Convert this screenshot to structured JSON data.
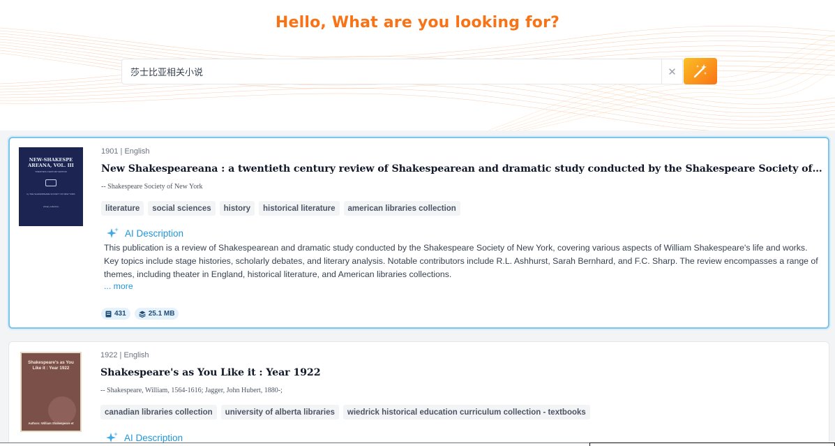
{
  "header": {
    "title": "Hello, What are you looking for?"
  },
  "search": {
    "value": "莎士比亚相关小说",
    "placeholder": "",
    "clear_icon": "close-icon",
    "submit_icon": "magic-wand-icon"
  },
  "colors": {
    "accent_orange": "#f97316",
    "link_blue": "#2096d8",
    "selected_border": "#7dc3ea"
  },
  "results": [
    {
      "meta": "1901 | English",
      "title": "New Shakespeareana : a twentieth century review of Shakespearean and dramatic study conducted by the Shakespeare Society of New York",
      "author": "-- Shakespeare Society of New York",
      "tags": [
        "literature",
        "social sciences",
        "history",
        "historical literature",
        "american libraries collection"
      ],
      "ai_label": "AI Description",
      "description": "This publication is a review of Shakespearean and dramatic study conducted by the Shakespeare Society of New York, covering various aspects of William Shakespeare's life and works. Key topics include stage histories, scholarly debates, and literary analysis. Notable contributors include R.L. Ashhurst, Sarah Bernhard, and F.C. Sharp. The review encompasses a range of themes, including theater in England, historical literature, and American libraries collections.",
      "more": "... more",
      "pages": "431",
      "size": "25.1 MB",
      "cover": {
        "title": "NEW-SHAKESPE AREANA, VOL. III",
        "subtitle": "TWENTIETH CENTURY EDITION",
        "line": "by THE SHAKESPEARE SOCIETY OF NEW YORK",
        "bottom": "Library collection"
      }
    },
    {
      "meta": "1922 | English",
      "title": "Shakespeare's as You Like it : Year 1922",
      "author": "-- Shakespeare, William, 1564-1616; Jagger, John Hubert, 1880-;",
      "tags": [
        "canadian libraries collection",
        "university of alberta libraries",
        "wiedrick historical education curriculum collection - textbooks"
      ],
      "ai_label": "AI Description",
      "cover": {
        "title": "Shakespeare's as You Like it : Year 1922",
        "bottom": "Authors: William Shakespeare et"
      }
    }
  ]
}
